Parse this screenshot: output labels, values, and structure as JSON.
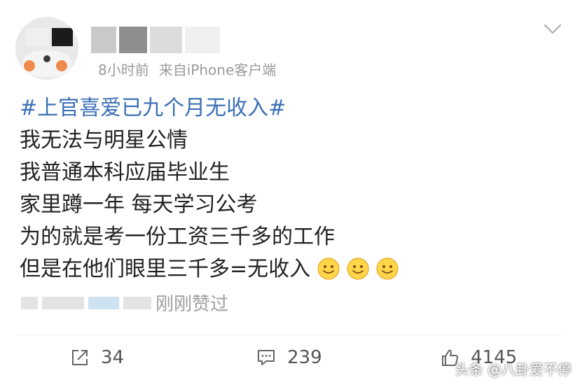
{
  "post": {
    "meta": {
      "time": "8小时前",
      "source": "来自iPhone客户端"
    },
    "topic": "#上官喜爱已九个月无收入#",
    "lines": [
      "我无法与明星公情",
      "我普通本科应届毕业生",
      "家里蹲一年 每天学习公考",
      "为的就是考一份工资三千多的工作",
      "但是在他们眼里三千多=无收入"
    ],
    "emoji_count": 3,
    "liked_by_suffix": "刚刚赞过"
  },
  "actions": {
    "repost_count": "34",
    "comment_count": "239",
    "like_count": "4145"
  },
  "watermark": "头条 @八卦爱不停",
  "colors": {
    "topic": "#3b6fb6",
    "meta": "#9a9a9a",
    "text": "#222222"
  },
  "icons": {
    "menu": "chevron-down-icon",
    "repost": "share-icon",
    "comment": "comment-icon",
    "like": "thumbs-up-icon",
    "emoji": "smiley-icon"
  }
}
